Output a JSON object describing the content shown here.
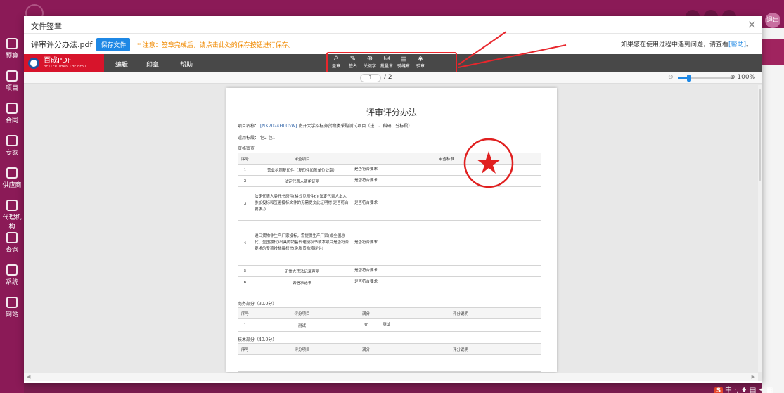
{
  "background": {
    "logout_label": "退出",
    "nav_items": [
      "预算",
      "项目",
      "合同",
      "专家",
      "供应商",
      "代理机构",
      "查询",
      "系统",
      "网站"
    ]
  },
  "dialog": {
    "title": "文件签章",
    "close_label": "×",
    "file_name": "评审评分办法.pdf",
    "save_button": "保存文件",
    "notice": "* 注意：签章完成后，请点击此处的保存按钮进行保存。",
    "help_prefix": "如果您在使用过程中遇到问题，请查看",
    "help_link": "[帮助]",
    "help_suffix": "。"
  },
  "viewer": {
    "brand": {
      "name": "百成PDF",
      "slogan": "BETTER THAN THE BEST"
    },
    "menu": [
      "编辑",
      "印章",
      "帮助"
    ],
    "tools": [
      {
        "icon": "person-seal-icon",
        "glyph": "♙",
        "label": "盖章"
      },
      {
        "icon": "pen-icon",
        "glyph": "✎",
        "label": "签名"
      },
      {
        "icon": "keyword-icon",
        "glyph": "⊕",
        "label": "关键字"
      },
      {
        "icon": "batch-seal-icon",
        "glyph": "⛁",
        "label": "批量章"
      },
      {
        "icon": "seam-seal-icon",
        "glyph": "▤",
        "label": "骑缝章"
      },
      {
        "icon": "verify-icon",
        "glyph": "◈",
        "label": "验章"
      }
    ],
    "page_current": "1",
    "page_total": "/ 2",
    "zoom_out": "⊖",
    "zoom_in": "⊕ 100%",
    "zoom_level": 1.0
  },
  "document": {
    "title": "评审评分办法",
    "project_label": "项目名称：",
    "project_code": "[NK2024H005W]",
    "project_name": "南开大学招标办货物类采购测试项目（进口、科研、分标段）",
    "lots": "适用标段：  包2   包1",
    "section_qual": "资格审查",
    "qual_headers": [
      "序号",
      "审查项目",
      "审查标准"
    ],
    "qual_rows": [
      {
        "no": "1",
        "item": "营业执照复印件（复印件加盖单位公章）",
        "std": "是否符合要求"
      },
      {
        "no": "2",
        "item": "法定代表人资格证明",
        "std": "是否符合要求"
      },
      {
        "no": "3",
        "item": "法定代表人委托书原件(格式见附件6)(法定代表人本人参加投标和签署投标文件的无需提交此证明材  是否符合要求。)",
        "std": "是否符合要求"
      },
      {
        "no": "4",
        "item": "进口货物非生产厂家投标，需提供生产厂家(或全国总代、全国独代)出具的销售代理授权书或本项目是否符合要求的专项投标授权书(免税货物须提供)",
        "std": "是否符合要求"
      },
      {
        "no": "5",
        "item": "无重大违法记录声明",
        "std": "是否符合要求"
      },
      {
        "no": "6",
        "item": "诚信承诺书",
        "std": "是否符合要求"
      }
    ],
    "section_business": "商务部分（30.0分）",
    "score_headers": [
      "序号",
      "评分项目",
      "满分",
      "评分说明"
    ],
    "business_rows": [
      {
        "no": "1",
        "item": "测试",
        "max": "30",
        "desc": "测试"
      }
    ],
    "section_tech": "技术部分（40.0分）"
  },
  "seal": {
    "text": "天津联速信息技术有限公司（测试）",
    "color": "#e02020"
  },
  "ime": {
    "logo": "S",
    "text": "中 ·, ♦ ▤ ✦ ▦"
  },
  "colors": {
    "brand_red": "#d7142b",
    "toolbar": "#484848",
    "accent": "#1e88e5",
    "app_purple": "#8b1a57",
    "notice": "#f08a00"
  }
}
